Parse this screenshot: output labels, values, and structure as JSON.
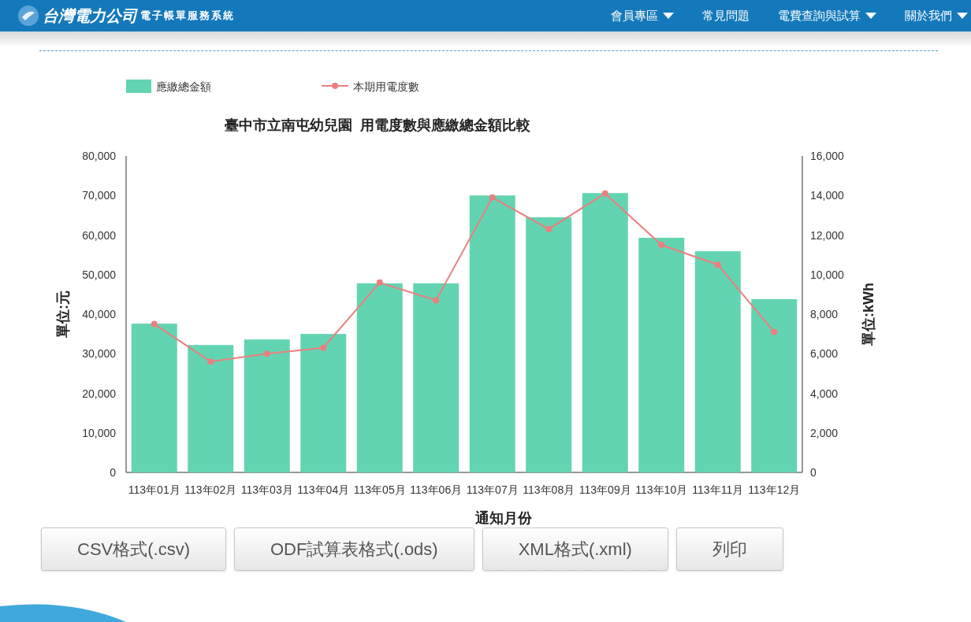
{
  "header": {
    "logo_text": "台灣電力公司",
    "system_name": "電子帳單服務系統",
    "nav": [
      {
        "label": "會員專區",
        "dropdown": true
      },
      {
        "label": "常見問題",
        "dropdown": false
      },
      {
        "label": "電費查詢與試算",
        "dropdown": true
      },
      {
        "label": "關於我們",
        "dropdown": true
      }
    ]
  },
  "chart": {
    "chart_data": {
      "type": "bar",
      "title": "臺中市立南屯幼兒園  用電度數與應繳總金額比較",
      "xlabel": "通知月份",
      "ylabel": "單位:元",
      "y2label": "單位:kWh",
      "stacked": false,
      "legend": "top-left",
      "categories": [
        "113年01月",
        "113年02月",
        "113年03月",
        "113年04月",
        "113年05月",
        "113年06月",
        "113年07月",
        "113年08月",
        "113年09月",
        "113年10月",
        "113年11月",
        "113年12月"
      ],
      "series": [
        {
          "name": "應繳總金額",
          "color": "#63d4b2",
          "values": [
            37600,
            32200,
            33600,
            35000,
            47800,
            47800,
            70000,
            64500,
            70600,
            59300,
            55900,
            43800
          ]
        },
        {
          "name": "本期用電度數",
          "type": "line",
          "axis": "y2",
          "marker": "circle",
          "color": "#eb7f7f",
          "values": [
            7500,
            5600,
            6000,
            6300,
            9600,
            8700,
            13900,
            12300,
            14100,
            11500,
            10500,
            7100
          ]
        }
      ],
      "ylim": [
        0,
        80000
      ],
      "y2lim": [
        0,
        16000
      ],
      "yticks": [
        {
          "value": 0,
          "label": "0"
        },
        {
          "value": 10000,
          "label": "10,000"
        },
        {
          "value": 20000,
          "label": "20,000"
        },
        {
          "value": 30000,
          "label": "30,000"
        },
        {
          "value": 40000,
          "label": "40,000"
        },
        {
          "value": 50000,
          "label": "50,000"
        },
        {
          "value": 60000,
          "label": "60,000"
        },
        {
          "value": 70000,
          "label": "70,000"
        },
        {
          "value": 80000,
          "label": "80,000"
        }
      ],
      "y2ticks": [
        {
          "value": 0,
          "label": "0"
        },
        {
          "value": 2000,
          "label": "2,000"
        },
        {
          "value": 4000,
          "label": "4,000"
        },
        {
          "value": 6000,
          "label": "6,000"
        },
        {
          "value": 8000,
          "label": "8,000"
        },
        {
          "value": 10000,
          "label": "10,000"
        },
        {
          "value": 12000,
          "label": "12,000"
        },
        {
          "value": 14000,
          "label": "14,000"
        },
        {
          "value": 16000,
          "label": "16,000"
        }
      ]
    }
  },
  "buttons": [
    "CSV格式(.csv)",
    "ODF試算表格式(.ods)",
    "XML格式(.xml)",
    "列印"
  ]
}
